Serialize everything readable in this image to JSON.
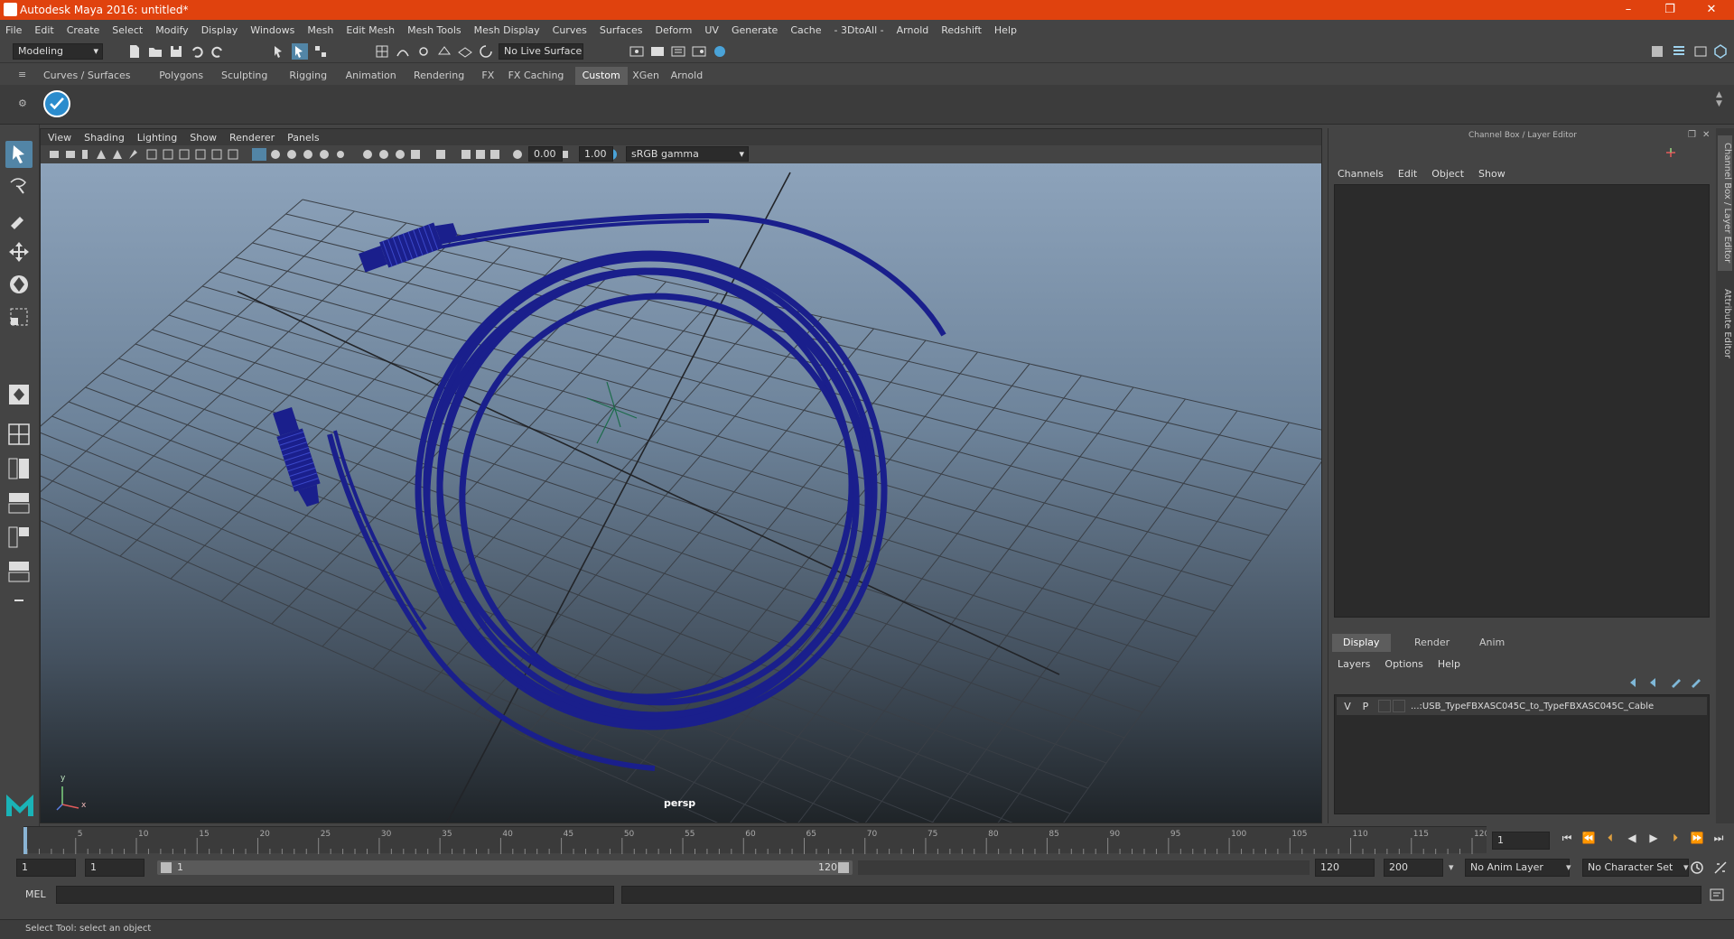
{
  "window": {
    "title": "Autodesk Maya 2016: untitled*",
    "minimize": "–",
    "restore": "❐",
    "close": "✕"
  },
  "menubar": [
    "File",
    "Edit",
    "Create",
    "Select",
    "Modify",
    "Display",
    "Windows",
    "Mesh",
    "Edit Mesh",
    "Mesh Tools",
    "Mesh Display",
    "Curves",
    "Surfaces",
    "Deform",
    "UV",
    "Generate",
    "Cache",
    "- 3DtoAll -",
    "Arnold",
    "Redshift",
    "Help"
  ],
  "statusline": {
    "menuset": "Modeling",
    "live_surface": "No Live Surface"
  },
  "shelf_tabs": [
    "Curves / Surfaces",
    "Polygons",
    "Sculpting",
    "Rigging",
    "Animation",
    "Rendering",
    "FX",
    "FX Caching",
    "Custom",
    "XGen",
    "Arnold"
  ],
  "shelf_active": "Custom",
  "viewport": {
    "menu": [
      "View",
      "Shading",
      "Lighting",
      "Show",
      "Renderer",
      "Panels"
    ],
    "exposure": "0.00",
    "gamma": "1.00",
    "color_space": "sRGB gamma",
    "camera_label": "persp",
    "axis_y": "y",
    "axis_x": "x"
  },
  "channel_box": {
    "title": "Channel Box / Layer Editor",
    "menu": [
      "Channels",
      "Edit",
      "Object",
      "Show"
    ],
    "layer_tabs": [
      "Display",
      "Render",
      "Anim"
    ],
    "layer_tab_active": "Display",
    "layer_menu": [
      "Layers",
      "Options",
      "Help"
    ],
    "layer": {
      "v": "V",
      "p": "P",
      "name": "...:USB_TypeFBXASC045C_to_TypeFBXASC045C_Cable"
    }
  },
  "side_tabs": [
    "Channel Box / Layer Editor",
    "Attribute Editor"
  ],
  "timeline": {
    "ticks": [
      5,
      10,
      15,
      20,
      25,
      30,
      35,
      40,
      45,
      50,
      55,
      60,
      65,
      70,
      75,
      80,
      85,
      90,
      95,
      100,
      105,
      110,
      115,
      120
    ],
    "start_label": "1",
    "current_frame": "1"
  },
  "range": {
    "start": "1",
    "playback_start": "1",
    "slider_start": "1",
    "slider_end": "120",
    "playback_end": "120",
    "end": "200",
    "anim_layer": "No Anim Layer",
    "char_set": "No Character Set"
  },
  "cmdline": {
    "label": "MEL"
  },
  "helpline": {
    "text": "Select Tool: select an object"
  },
  "colors": {
    "titlebar": "#e0420e",
    "wireframe": "#1a1f8c",
    "selected_tool": "#5285a6"
  }
}
